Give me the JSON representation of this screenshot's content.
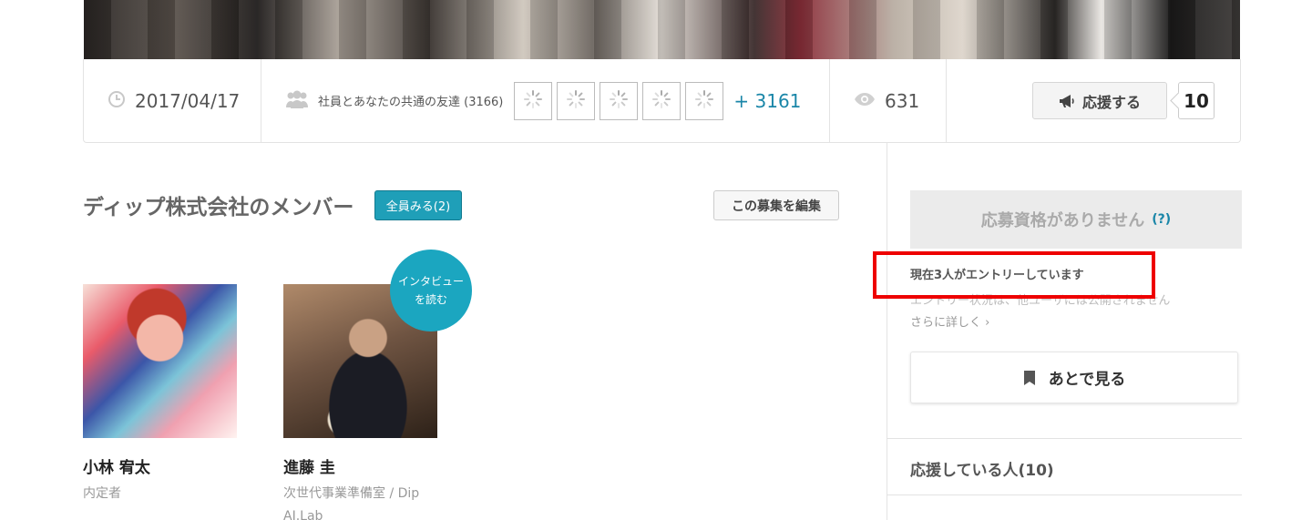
{
  "stats": {
    "date": "2017/04/17",
    "friends_label": "社員とあなたの共通の友達 (3166)",
    "friends_more": "+ 3161",
    "views": "631",
    "cheer_label": "応援する",
    "cheer_count": "10"
  },
  "members": {
    "title": "ディップ株式会社のメンバー",
    "see_all_label": "全員みる(2)",
    "edit_label": "この募集を編集",
    "interview_line1": "インタビュー",
    "interview_line2": "を読む",
    "list": [
      {
        "name": "小林 宥太",
        "role": "内定者"
      },
      {
        "name": "進藤 圭",
        "role": "次世代事業準備室 / Dip AI.Lab"
      }
    ]
  },
  "sidebar": {
    "no_qual_label": "応募資格がありません",
    "help_mark": "(?)",
    "entry_count_text": "現在3人がエントリーしています",
    "entry_note": "エントリー状況は、他ユーザには公開されません",
    "more_link": "さらに詳しく ›",
    "later_label": "あとで見る",
    "cheerers_label": "応援している人(10)"
  },
  "colors": {
    "accent": "#1f9fb8",
    "link": "#1a86a8",
    "highlight": "#ee0000"
  }
}
